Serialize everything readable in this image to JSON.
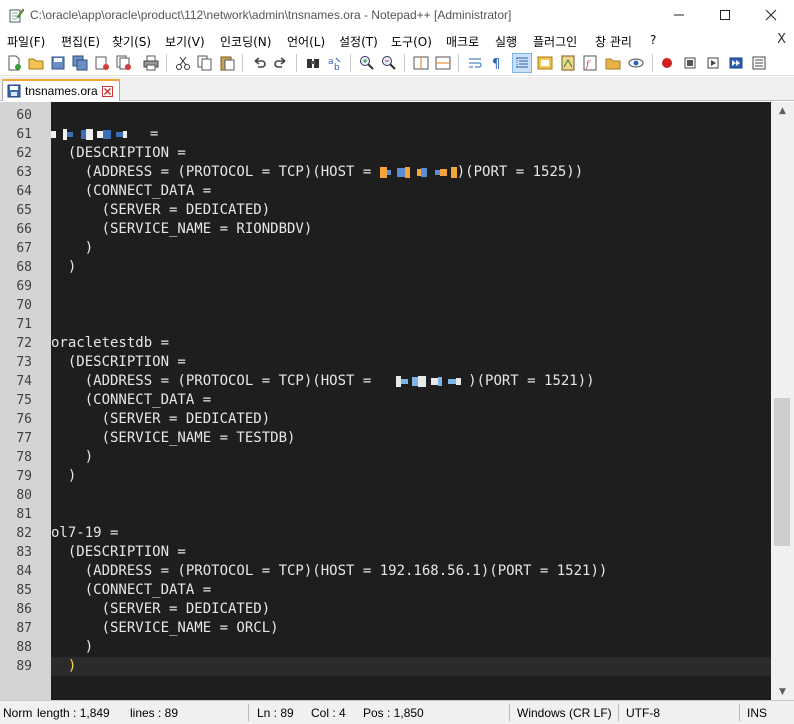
{
  "window": {
    "title": "C:\\oracle\\app\\oracle\\product\\112\\network\\admin\\tnsnames.ora - Notepad++ [Administrator]",
    "min_glyph": "—",
    "max_glyph": "☐",
    "close_glyph": "✕"
  },
  "menu": {
    "items": [
      "파일(F)",
      "편집(E)",
      "찾기(S)",
      "보기(V)",
      "인코딩(N)",
      "언어(L)",
      "설정(T)",
      "도구(O)",
      "매크로",
      "실행",
      "플러그인",
      "창 관리",
      "?"
    ],
    "close_glyph": "X"
  },
  "tab": {
    "label": "tnsnames.ora"
  },
  "editor": {
    "lines": [
      {
        "n": "60",
        "text": ""
      },
      {
        "n": "61",
        "text": "",
        "redacted_name": true,
        "suffix": "  ="
      },
      {
        "n": "62",
        "text": "  (DESCRIPTION ="
      },
      {
        "n": "63",
        "text": "    (ADDRESS = (PROTOCOL = TCP)(HOST = ",
        "redacted_host": true,
        "suffix": ")(PORT = 1525))"
      },
      {
        "n": "64",
        "text": "    (CONNECT_DATA ="
      },
      {
        "n": "65",
        "text": "      (SERVER = DEDICATED)"
      },
      {
        "n": "66",
        "text": "      (SERVICE_NAME = RIONDBDV)"
      },
      {
        "n": "67",
        "text": "    )"
      },
      {
        "n": "68",
        "text": "  )"
      },
      {
        "n": "69",
        "text": ""
      },
      {
        "n": "70",
        "text": ""
      },
      {
        "n": "71",
        "text": ""
      },
      {
        "n": "72",
        "text": "oracletestdb ="
      },
      {
        "n": "73",
        "text": "  (DESCRIPTION ="
      },
      {
        "n": "74",
        "text": "    (ADDRESS = (PROTOCOL = TCP)(HOST =  ",
        "redacted_host": true,
        "suffix": ")(PORT = 1521))"
      },
      {
        "n": "75",
        "text": "    (CONNECT_DATA ="
      },
      {
        "n": "76",
        "text": "      (SERVER = DEDICATED)"
      },
      {
        "n": "77",
        "text": "      (SERVICE_NAME = TESTDB)"
      },
      {
        "n": "78",
        "text": "    )"
      },
      {
        "n": "79",
        "text": "  )"
      },
      {
        "n": "80",
        "text": ""
      },
      {
        "n": "81",
        "text": ""
      },
      {
        "n": "82",
        "text": "ol7-19 ="
      },
      {
        "n": "83",
        "text": "  (DESCRIPTION ="
      },
      {
        "n": "84",
        "text": "    (ADDRESS = (PROTOCOL = TCP)(HOST = 192.168.56.1)(PORT = 1521))"
      },
      {
        "n": "85",
        "text": "    (CONNECT_DATA ="
      },
      {
        "n": "86",
        "text": "      (SERVER = DEDICATED)"
      },
      {
        "n": "87",
        "text": "      (SERVICE_NAME = ORCL)"
      },
      {
        "n": "88",
        "text": "    )"
      },
      {
        "n": "89",
        "text": "  )",
        "current": true
      }
    ]
  },
  "status": {
    "mode": "Norm",
    "length": "length : 1,849",
    "lines": "lines : 89",
    "ln": "Ln : 89",
    "col": "Col : 4",
    "pos": "Pos : 1,850",
    "eol": "Windows (CR LF)",
    "encoding": "UTF-8",
    "ins": "INS"
  },
  "colors": {
    "editor_bg": "#1e1e1e",
    "gutter_bg": "#d4d4d4",
    "text": "#e6e6e6",
    "current_line": "#2b2b2b",
    "brace_highlight": "#ffd84a",
    "tab_accent": "#f4a63a"
  },
  "icons": {
    "app": "notepad-icon",
    "tab_file": "save-disk-icon",
    "tab_close": "close-icon"
  }
}
